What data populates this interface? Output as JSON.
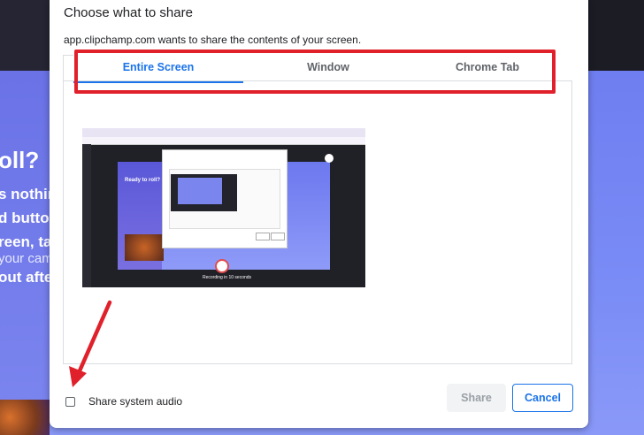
{
  "dialog": {
    "title": "Choose what to share",
    "subtitle": "app.clipchamp.com wants to share the contents of your screen.",
    "tabs": [
      {
        "label": "Entire Screen",
        "active": true
      },
      {
        "label": "Window",
        "active": false
      },
      {
        "label": "Chrome Tab",
        "active": false
      }
    ],
    "checkbox": {
      "label": "Share system audio",
      "checked": false
    },
    "buttons": {
      "share": "Share",
      "cancel": "Cancel"
    }
  },
  "background": {
    "lines": [
      "oll?",
      "s nothin",
      "d butto",
      "reen, tab",
      "your cam",
      "out after"
    ]
  },
  "thumbnail": {
    "heading": "Ready to roll?",
    "footer": "Recording in 10 seconds"
  },
  "colors": {
    "accent": "#1a73e8",
    "highlight": "#e0202a",
    "hero": "#7a8cf6"
  },
  "icons": {
    "annotation": "red-arrow-icon",
    "loading": "spinner-icon",
    "close": "close-icon"
  }
}
